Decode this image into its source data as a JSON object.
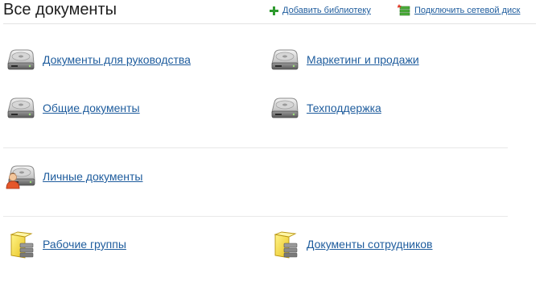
{
  "header": {
    "title": "Все документы",
    "add_library_label": "Добавить библиотеку",
    "connect_drive_label": "Подключить сетевой диск"
  },
  "libraries": [
    {
      "label": "Документы для руководства",
      "icon": "drive-icon"
    },
    {
      "label": "Маркетинг и продажи",
      "icon": "drive-icon"
    },
    {
      "label": "Общие документы",
      "icon": "drive-icon"
    },
    {
      "label": "Техподдержка",
      "icon": "drive-icon"
    },
    {
      "label": "Личные документы",
      "icon": "personal-drive-icon"
    },
    {
      "label": "Рабочие группы",
      "icon": "folder-drive-icon"
    },
    {
      "label": "Документы сотрудников",
      "icon": "folder-drive-icon"
    }
  ],
  "colors": {
    "link": "#1e5c9d",
    "add_icon": "#2e9a2e",
    "folder": "#f2d43a"
  }
}
